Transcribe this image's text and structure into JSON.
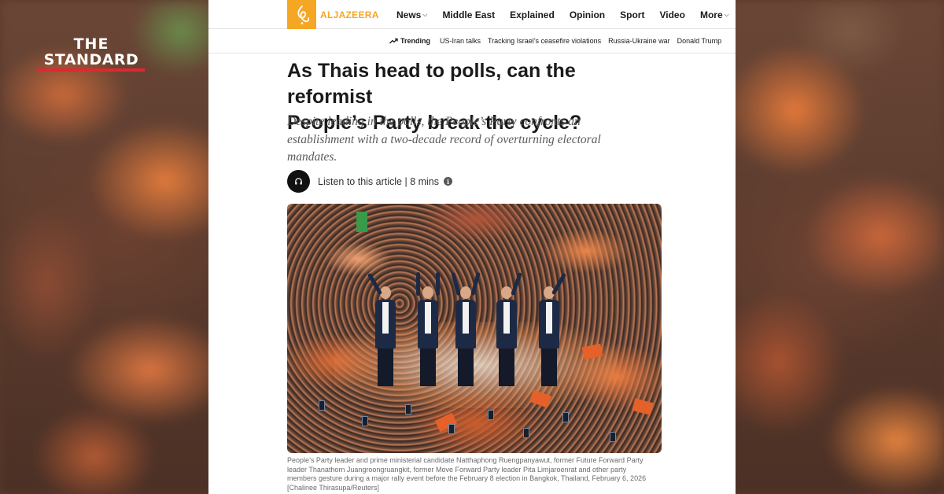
{
  "overlay": {
    "logo_line1": "THE",
    "logo_line2": "STANDARD"
  },
  "site": {
    "brand_name": "ALJAZEERA",
    "brand_color": "#f5a623",
    "nav": [
      {
        "label": "News",
        "has_dropdown": true
      },
      {
        "label": "Middle East",
        "has_dropdown": false
      },
      {
        "label": "Explained",
        "has_dropdown": false
      },
      {
        "label": "Opinion",
        "has_dropdown": false
      },
      {
        "label": "Sport",
        "has_dropdown": false
      },
      {
        "label": "Video",
        "has_dropdown": false
      },
      {
        "label": "More",
        "has_dropdown": true
      }
    ],
    "trending_label": "Trending",
    "trending": [
      "US-Iran talks",
      "Tracking Israel’s ceasefire violations",
      "Russia-Ukraine war",
      "Donald Trump"
    ]
  },
  "article": {
    "headline_line1": "As Thais head to polls, can the reformist",
    "headline_line2": "People’s Party break the cycle?",
    "deck": "Despite leading in the polls, the People’s Party confronts an establishment with a two-decade record of overturning electoral mandates.",
    "listen_text": "Listen to this article | 8 mins",
    "listen_icon": "headphones-icon",
    "info_icon": "info-icon",
    "caption": "People’s Party leader and prime ministerial candidate Natthaphong Ruengpanyawut, former Future Forward Party leader Thanathorn Juangroongruangkit, former Move Forward Party leader Pita Limjaroenrat and other party members gesture during a major rally event before the February 8 election in Bangkok, Thailand, February 6, 2026 [Chalinee Thirasupa/Reuters]"
  }
}
